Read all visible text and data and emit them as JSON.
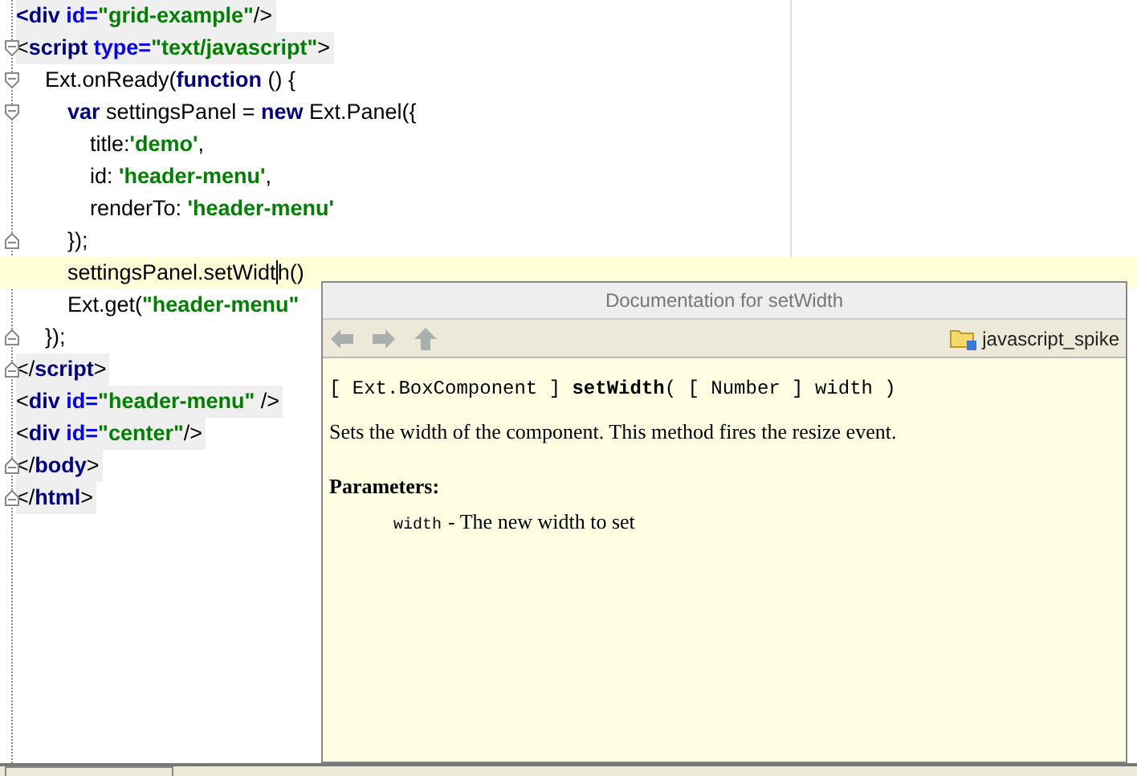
{
  "editor": {
    "lines": [
      {
        "kind": "markup",
        "current": false,
        "tokens": [
          {
            "kind": "tag",
            "s": "<"
          },
          {
            "kind": "tag",
            "s": "div"
          },
          {
            "kind": "attr",
            "s": " id="
          },
          {
            "kind": "str",
            "s": "\"grid-example\""
          },
          {
            "kind": "text",
            "s": "/>"
          }
        ]
      },
      {
        "kind": "markup",
        "fold": {
          "kind": "open"
        },
        "current": false,
        "tokens": [
          {
            "kind": "text",
            "s": "<"
          },
          {
            "kind": "tag",
            "s": "script"
          },
          {
            "kind": "attr",
            "s": " type="
          },
          {
            "kind": "str",
            "s": "\"text/javascript\""
          },
          {
            "kind": "text",
            "s": ">"
          }
        ],
        "children": [
          {
            "kind": "script",
            "fold": {
              "kind": "open"
            },
            "current": false,
            "tokens": [
              {
                "kind": "text",
                "s": "Ext.onReady("
              },
              {
                "kind": "kw",
                "s": "function"
              },
              {
                "kind": "text",
                "s": " () {"
              }
            ],
            "children": [
              {
                "kind": "script",
                "fold": {
                  "kind": "open"
                },
                "current": false,
                "tokens": [
                  {
                    "kind": "kw",
                    "s": "var"
                  },
                  {
                    "kind": "text",
                    "s": " settingsPanel = "
                  },
                  {
                    "kind": "kw",
                    "s": "new"
                  },
                  {
                    "kind": "text",
                    "s": " Ext.Panel({"
                  }
                ],
                "children": [
                  {
                    "kind": "script",
                    "current": false,
                    "tokens": [
                      {
                        "kind": "text",
                        "s": "title:"
                      },
                      {
                        "kind": "str",
                        "s": "'demo'"
                      },
                      {
                        "kind": "text",
                        "s": ","
                      }
                    ]
                  },
                  {
                    "kind": "script",
                    "current": false,
                    "tokens": [
                      {
                        "kind": "text",
                        "s": "id: "
                      },
                      {
                        "kind": "str",
                        "s": "'header-menu'"
                      },
                      {
                        "kind": "text",
                        "s": ","
                      }
                    ]
                  },
                  {
                    "kind": "script",
                    "current": false,
                    "tokens": [
                      {
                        "kind": "text",
                        "s": "renderTo: "
                      },
                      {
                        "kind": "str",
                        "s": "'header-menu'"
                      }
                    ]
                  }
                ]
              },
              {
                "kind": "script",
                "fold": {
                  "kind": "close"
                },
                "current": false,
                "tokens": [
                  {
                    "kind": "text",
                    "s": "});"
                  }
                ]
              },
              {
                "kind": "script",
                "current": true,
                "tokens": [
                  {
                    "kind": "text",
                    "s": "settingsPanel.setWidt"
                  },
                  {
                    "kind": "text",
                    "s": "h()",
                    "caret": true
                  }
                ]
              },
              {
                "kind": "script",
                "current": false,
                "tokens": [
                  {
                    "kind": "text",
                    "s": "Ext.get("
                  },
                  {
                    "kind": "str",
                    "s": "\"header-menu\""
                  }
                ]
              }
            ]
          },
          {
            "kind": "script",
            "fold": {
              "kind": "close"
            },
            "current": false,
            "tokens": [
              {
                "kind": "text",
                "s": "});"
              }
            ]
          }
        ]
      },
      {
        "kind": "markup",
        "fold": {
          "kind": "close"
        },
        "current": false,
        "tokens": [
          {
            "kind": "text",
            "s": "</"
          },
          {
            "kind": "tag",
            "s": "script"
          },
          {
            "kind": "text",
            "s": ">"
          }
        ]
      },
      {
        "kind": "markup",
        "current": false,
        "tokens": [
          {
            "kind": "text",
            "s": "<"
          },
          {
            "kind": "tag",
            "s": "div"
          },
          {
            "kind": "attr",
            "s": " id="
          },
          {
            "kind": "str",
            "s": "\"header-menu\""
          },
          {
            "kind": "text",
            "s": " />"
          }
        ]
      },
      {
        "kind": "markup",
        "current": false,
        "tokens": [
          {
            "kind": "text",
            "s": "<"
          },
          {
            "kind": "tag",
            "s": "div"
          },
          {
            "kind": "attr",
            "s": " id="
          },
          {
            "kind": "str",
            "s": "\"center\""
          },
          {
            "kind": "text",
            "s": "/>"
          }
        ]
      },
      {
        "kind": "markup",
        "fold": {
          "kind": "close"
        },
        "current": false,
        "tokens": [
          {
            "kind": "text",
            "s": "</"
          },
          {
            "kind": "tag",
            "s": "body"
          },
          {
            "kind": "text",
            "s": ">"
          }
        ]
      },
      {
        "kind": "markup",
        "fold": {
          "kind": "close"
        },
        "current": false,
        "tokens": [
          {
            "kind": "text",
            "s": "</"
          },
          {
            "kind": "tag",
            "s": "html"
          },
          {
            "kind": "text",
            "s": ">"
          }
        ]
      }
    ]
  },
  "doc_popup": {
    "title": "Documentation for setWidth",
    "toolbar": [
      {
        "kind": "back",
        "disabled": true
      },
      {
        "kind": "forward",
        "disabled": true
      },
      {
        "kind": "up",
        "disabled": true
      }
    ],
    "location": "javascript_spike",
    "signature": "[ Ext.BoxComponent ] **setWidth**(  [ Number ] width  )",
    "description": "Sets the width of the component. This method fires the resize event.",
    "params_heading": "Parameters:",
    "params": [
      {
        "name": "width",
        "description": "- The new width to set"
      }
    ]
  }
}
